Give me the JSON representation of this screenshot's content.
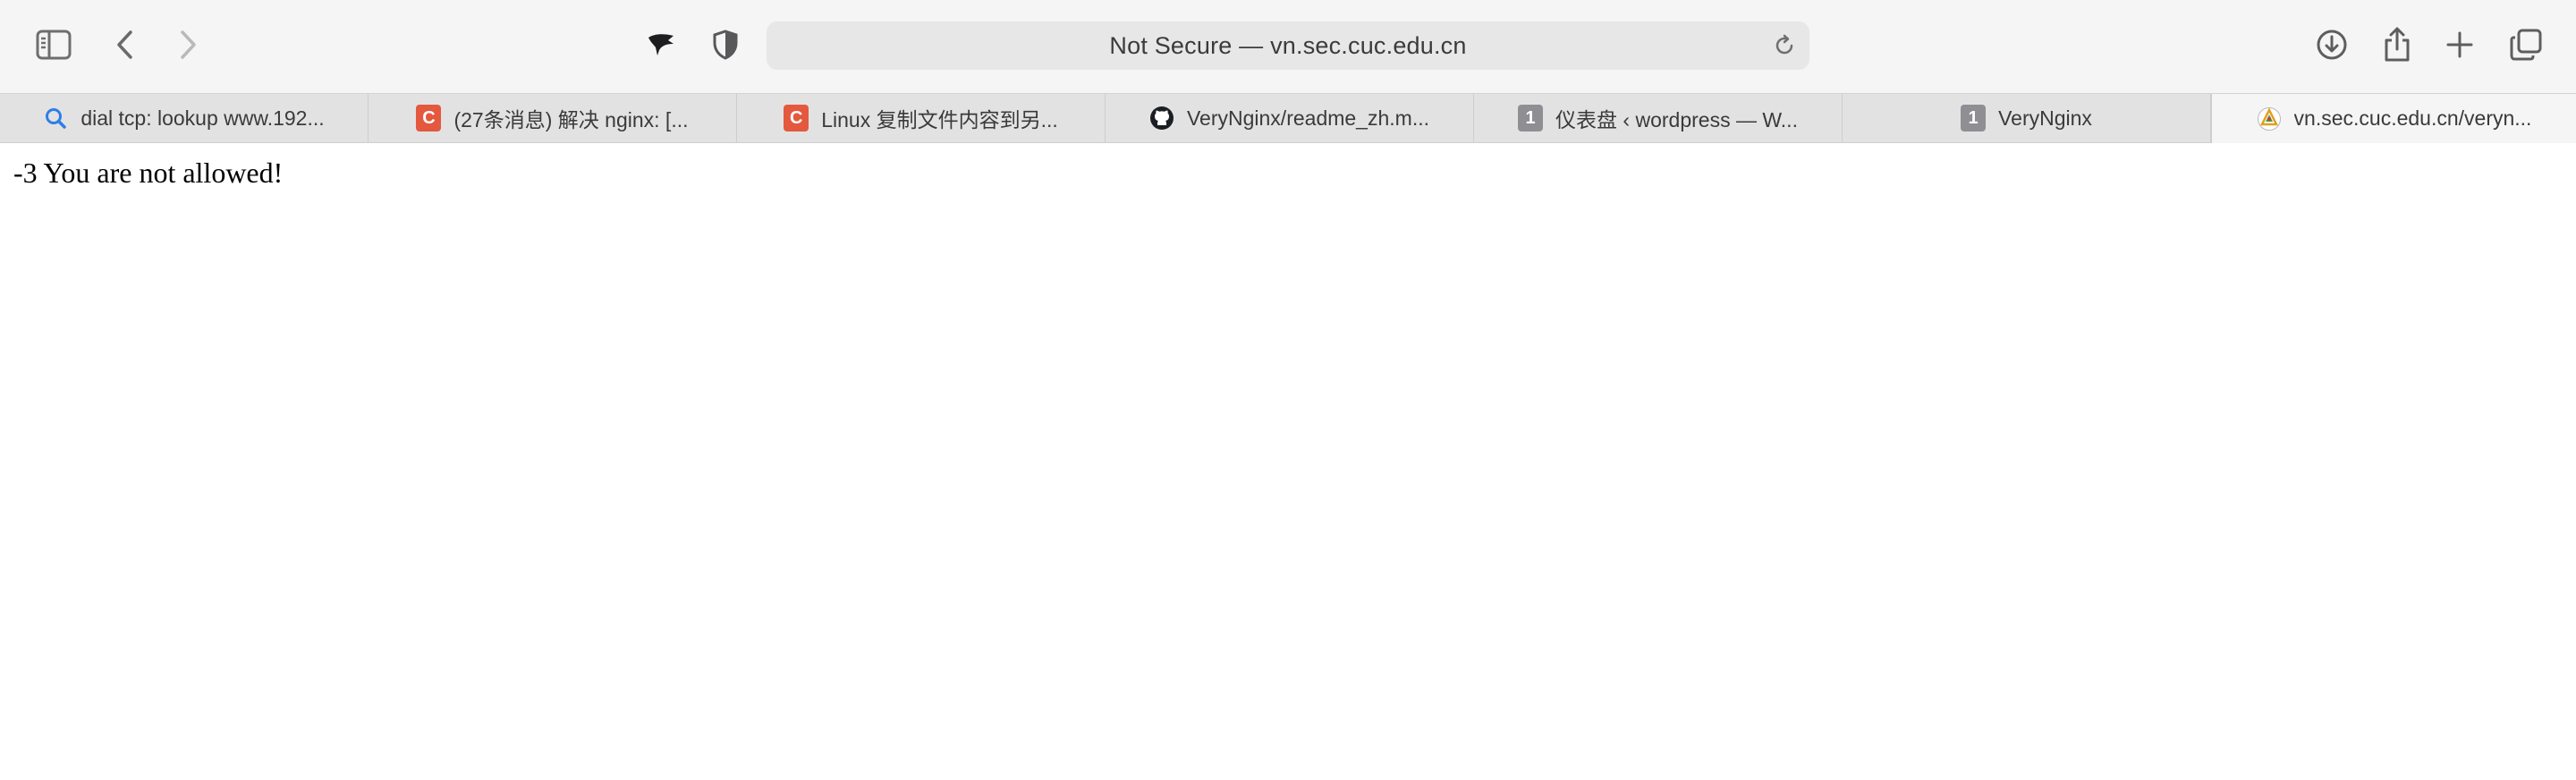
{
  "browser": {
    "address_bar": {
      "text": "Not Secure — vn.sec.cuc.edu.cn"
    },
    "icons": {
      "sidebar": "sidebar-icon",
      "back": "chevron-left-icon",
      "forward": "chevron-right-icon",
      "extension": "bird-icon",
      "privacy": "shield-icon",
      "reload": "reload-icon",
      "downloads": "download-icon",
      "share": "share-icon",
      "new_tab": "plus-icon",
      "tab_overview": "tabs-icon"
    }
  },
  "tabs": [
    {
      "title": "dial tcp: lookup www.192...",
      "favicon": "search-icon",
      "active": false
    },
    {
      "title": "(27条消息) 解决 nginx: [...",
      "favicon": "C",
      "active": false
    },
    {
      "title": "Linux 复制文件内容到另...",
      "favicon": "C",
      "active": false
    },
    {
      "title": "VeryNginx/readme_zh.m...",
      "favicon": "github-icon",
      "active": false
    },
    {
      "title": "仪表盘 ‹ wordpress — W...",
      "favicon": "1",
      "active": false
    },
    {
      "title": "VeryNginx",
      "favicon": "1",
      "active": false
    },
    {
      "title": "vn.sec.cuc.edu.cn/veryn...",
      "favicon": "site-logo-icon",
      "active": true
    }
  ],
  "page": {
    "message": "-3 You are not allowed!"
  },
  "colors": {
    "toolbar_bg": "#f6f5f6",
    "tabstrip_bg": "#e3e2e3",
    "address_bg": "#e8e7e8",
    "csdn_red": "#e4583e",
    "badge_gray": "#8e8e93"
  }
}
